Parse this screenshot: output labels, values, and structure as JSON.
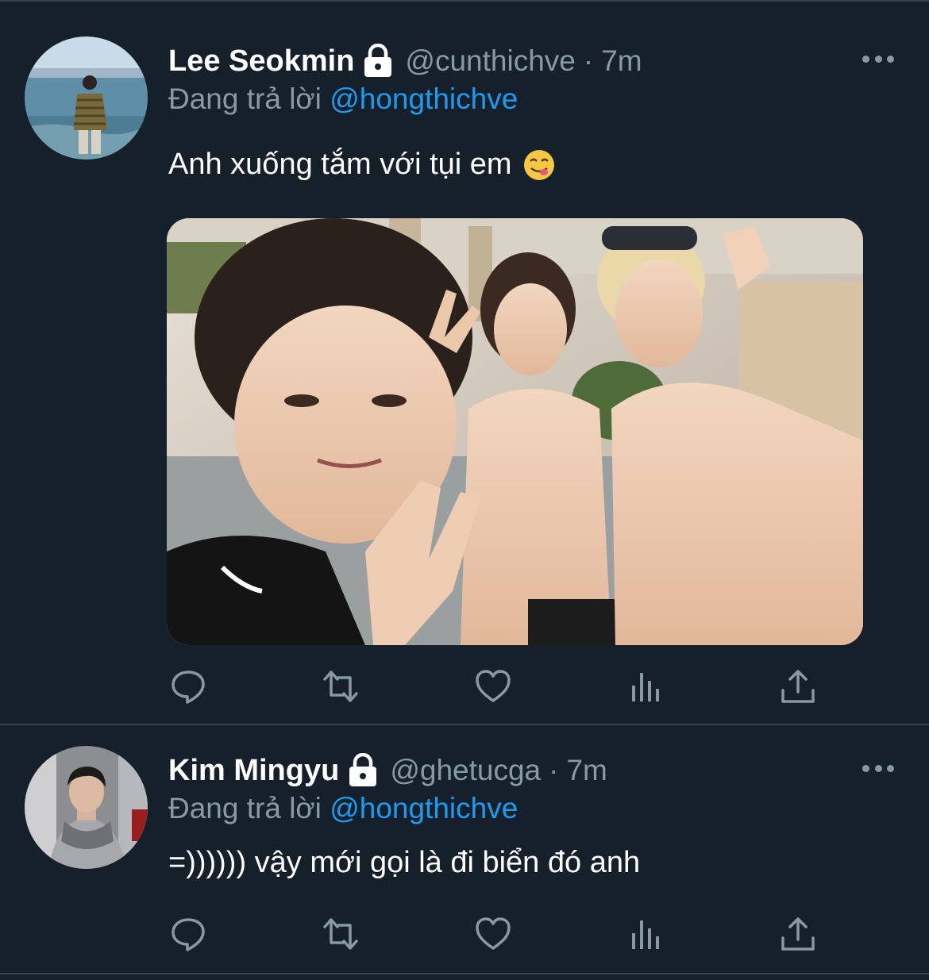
{
  "theme": {
    "background": "#15202b",
    "divider": "#38444d",
    "muted": "#8899a6",
    "accent": "#1d9bf0",
    "text": "#ffffff"
  },
  "tweets": [
    {
      "author_name": "Lee Seokmin",
      "handle": "@cunthichve",
      "separator": "·",
      "time": "7m",
      "replying_prefix": "Đang trả lời",
      "replying_to": "@hongthichve",
      "text": "Anh xuống tắm với tụi em",
      "emoji": "face-savoring-food-emoji",
      "has_photo": true,
      "icons": [
        "lock-icon",
        "more-icon",
        "reply-icon",
        "retweet-icon",
        "like-icon",
        "analytics-icon",
        "share-icon"
      ]
    },
    {
      "author_name": "Kim Mingyu",
      "handle": "@ghetucga",
      "separator": "·",
      "time": "7m",
      "replying_prefix": "Đang trả lời",
      "replying_to": "@hongthichve",
      "text": "=)))))) vậy mới gọi là đi biển đó anh",
      "has_photo": false,
      "icons": [
        "lock-icon",
        "more-icon",
        "reply-icon",
        "retweet-icon",
        "like-icon",
        "analytics-icon",
        "share-icon"
      ]
    }
  ]
}
